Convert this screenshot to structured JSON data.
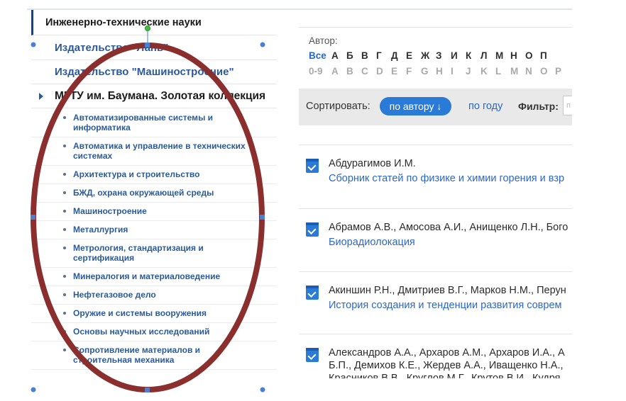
{
  "sidebar": {
    "category": "Инженерно-технические науки",
    "publishers": [
      "Издательство \"Лань\"",
      "Издательство \"Машиностроение\""
    ],
    "expanded": "МГТУ им. Баумана. Золотая коллекция",
    "subitems": [
      {
        "line1": "Автоматизированные системы и",
        "line2": "информатика"
      },
      {
        "line1": "Автоматика и управление в технических",
        "line2": "системах"
      },
      {
        "line1": "Архитектура и строительство",
        "line2": ""
      },
      {
        "line1": "БЖД, охрана окружающей среды",
        "line2": ""
      },
      {
        "line1": "Машиностроение",
        "line2": ""
      },
      {
        "line1": "Металлургия",
        "line2": ""
      },
      {
        "line1": "Метрология, стандартизация и",
        "line2": "сертификация"
      },
      {
        "line1": "Минералогия и материаловедение",
        "line2": ""
      },
      {
        "line1": "Нефтегазовое дело",
        "line2": ""
      },
      {
        "line1": "Оружие и системы вооружения",
        "line2": ""
      },
      {
        "line1": "Основы научных исследований",
        "line2": ""
      },
      {
        "line1": "Сопротивление материалов и",
        "line2": "строительная механика"
      }
    ]
  },
  "filter": {
    "author_label": "Автор:",
    "cyr_letters": [
      "Все",
      "А",
      "Б",
      "В",
      "Г",
      "Д",
      "Е",
      "Ж",
      "З",
      "И",
      "К",
      "Л",
      "М",
      "Н",
      "О",
      "П"
    ],
    "lat_letters": [
      "0-9",
      "A",
      "B",
      "C",
      "D",
      "E",
      "F",
      "G",
      "H",
      "I",
      "J",
      "K",
      "L",
      "M",
      "N",
      "O",
      "P"
    ],
    "sort_label": "Сортировать:",
    "sort_active": "по автору ↓",
    "sort_year": "по году",
    "filter_label": "Фильтр:",
    "filter_placeholder": "п"
  },
  "books": [
    {
      "authors": [
        "Абдурагимов И.М."
      ],
      "title": "Сборник статей по физике и химии горения и взр"
    },
    {
      "authors": [
        "Абрамов А.В., Амосова А.И., Анищенко Л.Н., Бого"
      ],
      "title": "Биорадиолокация"
    },
    {
      "authors": [
        "Акиншин Р.Н., Дмитриев В.Г., Марков Н.М., Перун"
      ],
      "title": "История создания и тенденции развития соврем"
    },
    {
      "authors": [
        "Александров А.А., Архаров А.М., Архаров И.А., А",
        "Б.П., Демихов К.Е., Жердев А.А., Иващенко Н.А.,",
        "Красников В.В., Круглов М.Г., Крутов В.И., Кудря"
      ],
      "title": ""
    }
  ],
  "colors": {
    "accent": "#2a7ad8",
    "link": "#2a67c9",
    "annotation": "#8b2e2e",
    "handle": "#4a7fd4"
  }
}
